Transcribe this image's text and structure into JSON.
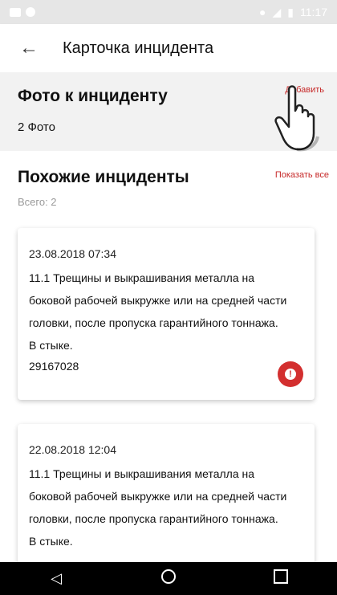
{
  "status_bar": {
    "time": "11:17"
  },
  "app_bar": {
    "title": "Карточка инцидента"
  },
  "photos": {
    "title": "Фото к инциденту",
    "count": "2 Фото",
    "add_label": "Добавить"
  },
  "similar": {
    "title": "Похожие инциденты",
    "show_all": "Показать все",
    "total": "Всего: 2",
    "cards": [
      {
        "date": "23.08.2018 07:34",
        "desc_lines": [
          "11.1 Трещины и выкрашивания металла на",
          "боковой рабочей выкружке или на средней части",
          "головки, после пропуска гарантийного тоннажа.",
          "В стыке."
        ],
        "number": "29167028"
      },
      {
        "date": "22.08.2018 12:04",
        "desc_lines": [
          "11.1 Трещины и выкрашивания металла на",
          "боковой рабочей выкружке или на средней части",
          "головки, после пропуска гарантийного тоннажа.",
          "В стыке."
        ]
      }
    ]
  },
  "colors": {
    "accent": "#d32f2f",
    "nav_bar": "#000000"
  },
  "icons": {
    "back": "arrow-left-icon",
    "alert": "exclamation-icon",
    "nav_back": "triangle-left-icon",
    "nav_home": "circle-icon",
    "nav_recents": "square-icon",
    "pointer": "hand-pointer-icon"
  }
}
